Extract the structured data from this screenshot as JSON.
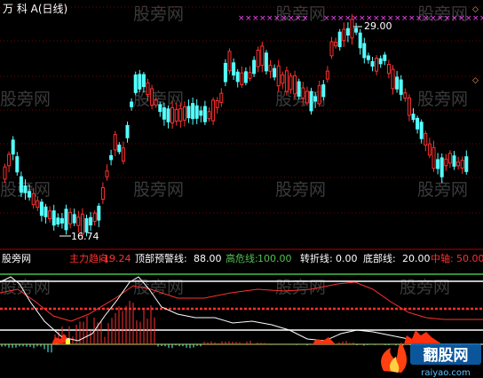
{
  "main_panel": {
    "title": "万 科 A(日线)",
    "high_label": "29.00",
    "low_label": "16.74",
    "colors": {
      "up": "#ff3030",
      "down": "#54ffff",
      "dot_grid": "#8a0000",
      "marker": "#ff40ff"
    }
  },
  "indicator_panel": {
    "name": "股旁网",
    "items": [
      {
        "label": "主力趋向:",
        "value": "-19.24",
        "color": "#ff3030"
      },
      {
        "label": "顶部预警线:",
        "value": "88.00",
        "color": "#ffffff"
      },
      {
        "label": "高危线:",
        "value": "100.00",
        "color": "#50c050"
      },
      {
        "label": "转折线:",
        "value": "0.00",
        "color": "#ffffff"
      },
      {
        "label": "底部线:",
        "value": "20.00",
        "color": "#ffffff"
      },
      {
        "label": "中轴:",
        "value": "50.00",
        "color": "#ff3030"
      }
    ]
  },
  "watermark": {
    "text": "股旁网"
  },
  "logo": {
    "text": "翻股网",
    "sub": "raiyao.com"
  }
}
